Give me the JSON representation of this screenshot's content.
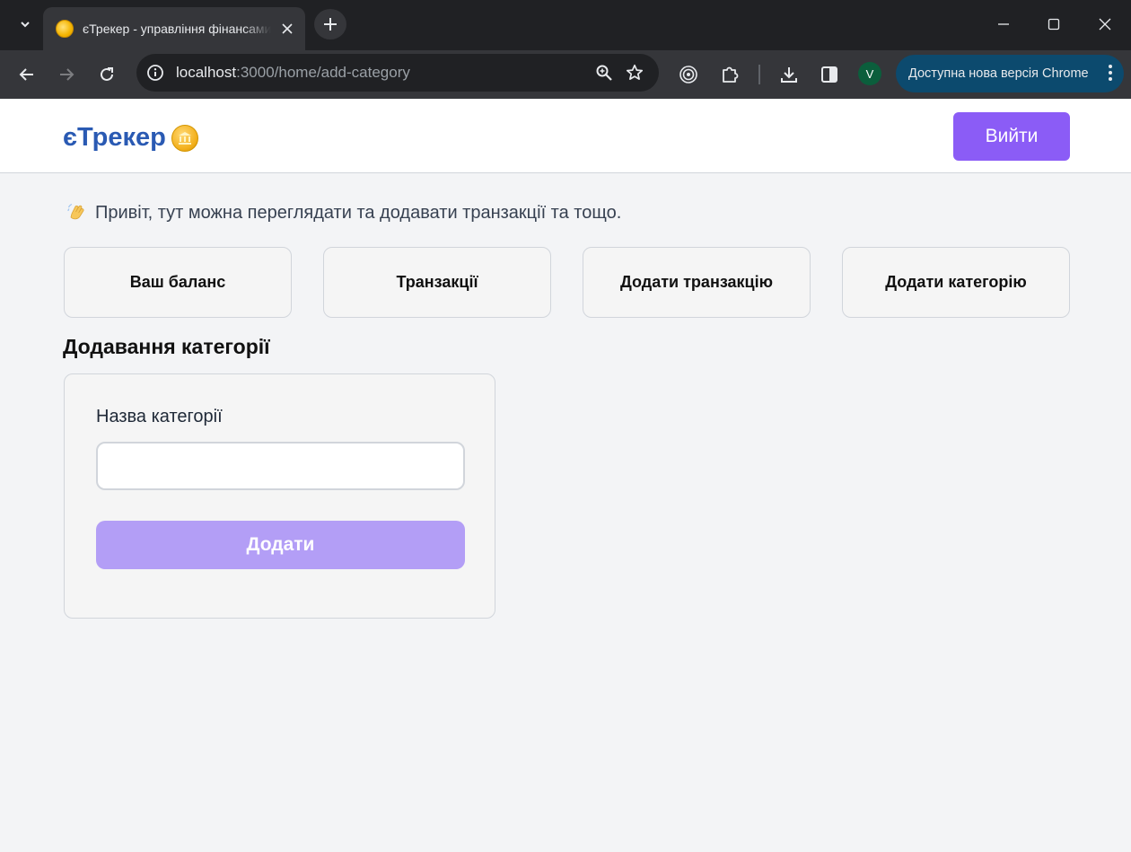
{
  "browser": {
    "tab": {
      "title": "єТрекер - управління фінансами",
      "favicon": "coin-icon"
    },
    "address_bar": {
      "host": "localhost",
      "path": ":3000/home/add-category"
    },
    "update_pill": "Доступна нова версія Chrome",
    "profile_initial": "V"
  },
  "header": {
    "logo_text": "єТрекер",
    "logo_icon": "coin-icon",
    "logout_label": "Вийти",
    "accent_color": "#8b5cf6"
  },
  "greeting": {
    "emoji": "👋",
    "text": "Привіт, тут можна переглядати та додавати транзакції та тощо."
  },
  "nav_cards": [
    {
      "label": "Ваш баланс"
    },
    {
      "label": "Транзакції"
    },
    {
      "label": "Додати транзакцію"
    },
    {
      "label": "Додати категорію"
    }
  ],
  "section": {
    "title": "Додавання категорії"
  },
  "form": {
    "label": "Назва категорії",
    "value": "",
    "placeholder": "",
    "submit_label": "Додати"
  }
}
